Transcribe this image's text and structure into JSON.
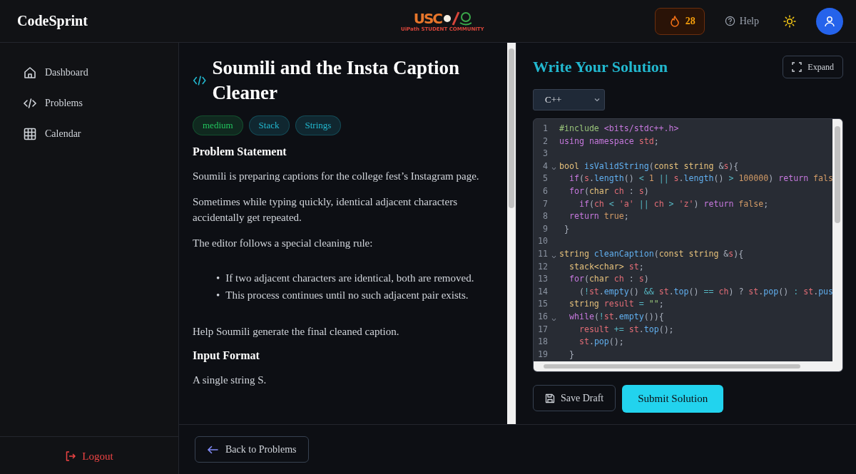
{
  "header": {
    "brand": "CodeSprint",
    "logo": {
      "mark": "USC",
      "tagline": "UiPath STUDENT COMMUNITY"
    },
    "streak": "28",
    "help": "Help"
  },
  "sidebar": {
    "items": [
      {
        "label": "Dashboard",
        "kind": "home"
      },
      {
        "label": "Problems",
        "kind": "code"
      },
      {
        "label": "Calendar",
        "kind": "grid"
      }
    ],
    "logout": "Logout"
  },
  "problem": {
    "title": "Soumili and the Insta Caption Cleaner",
    "tags": [
      {
        "label": "medium",
        "color": "#22c55e"
      },
      {
        "label": "Stack",
        "color": "#22b8cf"
      },
      {
        "label": "Strings",
        "color": "#22b8cf"
      }
    ],
    "blocks": [
      {
        "kind": "heading",
        "text": "Problem Statement"
      },
      {
        "kind": "para",
        "text": "Soumili is preparing captions for the college fest’s Instagram page."
      },
      {
        "kind": "para",
        "text": "Sometimes while typing quickly, identical adjacent characters accidentally get repeated."
      },
      {
        "kind": "para",
        "text": "The editor follows a special cleaning rule:"
      },
      {
        "kind": "bullets",
        "items": [
          {
            "marker": "•",
            "text": "If two adjacent characters are identical, both are removed."
          },
          {
            "marker": "•",
            "text": "This process continues until no such adjacent pair exists."
          }
        ]
      },
      {
        "kind": "para",
        "text": "Help Soumili generate the final cleaned caption."
      },
      {
        "kind": "heading",
        "text": "Input Format"
      },
      {
        "kind": "para",
        "text": "A single string S."
      }
    ]
  },
  "back_button": "Back to Problems",
  "solution": {
    "title": "Write Your Solution",
    "expand": "Expand",
    "language": "C++",
    "code": [
      {
        "number": "1",
        "foldable": false,
        "tokens": [
          {
            "kind": "directive",
            "text": "#include"
          },
          {
            "kind": "keyword",
            "text": " <bits/stdc++.h>"
          }
        ]
      },
      {
        "number": "2",
        "foldable": false,
        "tokens": [
          {
            "kind": "keyword",
            "text": "using namespace"
          },
          {
            "kind": "variable",
            "text": " std"
          },
          {
            "kind": "plain",
            "text": ";"
          }
        ]
      },
      {
        "number": "3",
        "foldable": false
      },
      {
        "number": "4",
        "foldable": true,
        "tokens": [
          {
            "kind": "type",
            "text": "bool"
          },
          {
            "kind": "function",
            "text": " isValidString"
          },
          {
            "kind": "plain",
            "text": "("
          },
          {
            "kind": "type",
            "text": "const string"
          },
          {
            "kind": "plain",
            "text": " &"
          },
          {
            "kind": "variable",
            "text": "s"
          },
          {
            "kind": "plain",
            "text": "){"
          }
        ]
      },
      {
        "number": "5",
        "foldable": false,
        "tokens": [
          {
            "kind": "keyword",
            "text": "  if"
          },
          {
            "kind": "plain",
            "text": "("
          },
          {
            "kind": "variable",
            "text": "s"
          },
          {
            "kind": "plain",
            "text": "."
          },
          {
            "kind": "function",
            "text": "length"
          },
          {
            "kind": "plain",
            "text": "() "
          },
          {
            "kind": "operator",
            "text": "<"
          },
          {
            "kind": "number",
            "text": " 1"
          },
          {
            "kind": "operator",
            "text": " ||"
          },
          {
            "kind": "variable",
            "text": " s"
          },
          {
            "kind": "plain",
            "text": "."
          },
          {
            "kind": "function",
            "text": "length"
          },
          {
            "kind": "plain",
            "text": "() "
          },
          {
            "kind": "operator",
            "text": ">"
          },
          {
            "kind": "number",
            "text": " 100000"
          },
          {
            "kind": "plain",
            "text": ") "
          },
          {
            "kind": "keyword",
            "text": "return"
          },
          {
            "kind": "number",
            "text": " fals"
          }
        ]
      },
      {
        "number": "6",
        "foldable": false,
        "tokens": [
          {
            "kind": "keyword",
            "text": "  for"
          },
          {
            "kind": "plain",
            "text": "("
          },
          {
            "kind": "type",
            "text": "char"
          },
          {
            "kind": "variable",
            "text": " ch"
          },
          {
            "kind": "plain",
            "text": " : "
          },
          {
            "kind": "variable",
            "text": "s"
          },
          {
            "kind": "plain",
            "text": ")"
          }
        ]
      },
      {
        "number": "7",
        "foldable": false,
        "tokens": [
          {
            "kind": "keyword",
            "text": "    if"
          },
          {
            "kind": "plain",
            "text": "("
          },
          {
            "kind": "variable",
            "text": "ch"
          },
          {
            "kind": "operator",
            "text": " <"
          },
          {
            "kind": "variable",
            "text": " 'a'"
          },
          {
            "kind": "operator",
            "text": " ||"
          },
          {
            "kind": "variable",
            "text": " ch"
          },
          {
            "kind": "operator",
            "text": " >"
          },
          {
            "kind": "variable",
            "text": " 'z'"
          },
          {
            "kind": "plain",
            "text": ") "
          },
          {
            "kind": "keyword",
            "text": "return"
          },
          {
            "kind": "number",
            "text": " false"
          },
          {
            "kind": "plain",
            "text": ";"
          }
        ]
      },
      {
        "number": "8",
        "foldable": false,
        "tokens": [
          {
            "kind": "keyword",
            "text": "  return"
          },
          {
            "kind": "number",
            "text": " true"
          },
          {
            "kind": "plain",
            "text": ";"
          }
        ]
      },
      {
        "number": "9",
        "foldable": false,
        "tokens": [
          {
            "kind": "plain",
            "text": " }"
          }
        ]
      },
      {
        "number": "10",
        "foldable": false
      },
      {
        "number": "11",
        "foldable": true,
        "tokens": [
          {
            "kind": "type",
            "text": "string"
          },
          {
            "kind": "function",
            "text": " cleanCaption"
          },
          {
            "kind": "plain",
            "text": "("
          },
          {
            "kind": "type",
            "text": "const string"
          },
          {
            "kind": "plain",
            "text": " &"
          },
          {
            "kind": "variable",
            "text": "s"
          },
          {
            "kind": "plain",
            "text": "){"
          }
        ]
      },
      {
        "number": "12",
        "foldable": false,
        "tokens": [
          {
            "kind": "type",
            "text": "  stack<char>"
          },
          {
            "kind": "variable",
            "text": " st"
          },
          {
            "kind": "plain",
            "text": ";"
          }
        ]
      },
      {
        "number": "13",
        "foldable": false,
        "tokens": [
          {
            "kind": "keyword",
            "text": "  for"
          },
          {
            "kind": "plain",
            "text": "("
          },
          {
            "kind": "type",
            "text": "char"
          },
          {
            "kind": "variable",
            "text": " ch"
          },
          {
            "kind": "plain",
            "text": " : "
          },
          {
            "kind": "variable",
            "text": "s"
          },
          {
            "kind": "plain",
            "text": ")"
          }
        ]
      },
      {
        "number": "14",
        "foldable": false,
        "tokens": [
          {
            "kind": "plain",
            "text": "    ("
          },
          {
            "kind": "operator",
            "text": "!"
          },
          {
            "kind": "variable",
            "text": "st"
          },
          {
            "kind": "plain",
            "text": "."
          },
          {
            "kind": "function",
            "text": "empty"
          },
          {
            "kind": "plain",
            "text": "() "
          },
          {
            "kind": "operator",
            "text": "&&"
          },
          {
            "kind": "variable",
            "text": " st"
          },
          {
            "kind": "plain",
            "text": "."
          },
          {
            "kind": "function",
            "text": "top"
          },
          {
            "kind": "plain",
            "text": "() "
          },
          {
            "kind": "operator",
            "text": "=="
          },
          {
            "kind": "variable",
            "text": " ch"
          },
          {
            "kind": "plain",
            "text": ") ? "
          },
          {
            "kind": "variable",
            "text": "st"
          },
          {
            "kind": "plain",
            "text": "."
          },
          {
            "kind": "function",
            "text": "pop"
          },
          {
            "kind": "plain",
            "text": "() "
          },
          {
            "kind": "operator",
            "text": ":"
          },
          {
            "kind": "variable",
            "text": " st"
          },
          {
            "kind": "plain",
            "text": "."
          },
          {
            "kind": "function",
            "text": "pus"
          }
        ]
      },
      {
        "number": "15",
        "foldable": false,
        "tokens": [
          {
            "kind": "type",
            "text": "  string"
          },
          {
            "kind": "variable",
            "text": " result"
          },
          {
            "kind": "operator",
            "text": " ="
          },
          {
            "kind": "string",
            "text": " \"\""
          },
          {
            "kind": "plain",
            "text": ";"
          }
        ]
      },
      {
        "number": "16",
        "foldable": true,
        "tokens": [
          {
            "kind": "keyword",
            "text": "  while"
          },
          {
            "kind": "plain",
            "text": "("
          },
          {
            "kind": "operator",
            "text": "!"
          },
          {
            "kind": "variable",
            "text": "st"
          },
          {
            "kind": "plain",
            "text": "."
          },
          {
            "kind": "function",
            "text": "empty"
          },
          {
            "kind": "plain",
            "text": "()){"
          }
        ]
      },
      {
        "number": "17",
        "foldable": false,
        "tokens": [
          {
            "kind": "variable",
            "text": "    result"
          },
          {
            "kind": "operator",
            "text": " +="
          },
          {
            "kind": "variable",
            "text": " st"
          },
          {
            "kind": "plain",
            "text": "."
          },
          {
            "kind": "function",
            "text": "top"
          },
          {
            "kind": "plain",
            "text": "();"
          }
        ]
      },
      {
        "number": "18",
        "foldable": false,
        "tokens": [
          {
            "kind": "variable",
            "text": "    st"
          },
          {
            "kind": "plain",
            "text": "."
          },
          {
            "kind": "function",
            "text": "pop"
          },
          {
            "kind": "plain",
            "text": "();"
          }
        ]
      },
      {
        "number": "19",
        "foldable": false,
        "tokens": [
          {
            "kind": "plain",
            "text": "  }"
          }
        ]
      }
    ],
    "save": "Save Draft",
    "submit": "Submit Solution"
  }
}
